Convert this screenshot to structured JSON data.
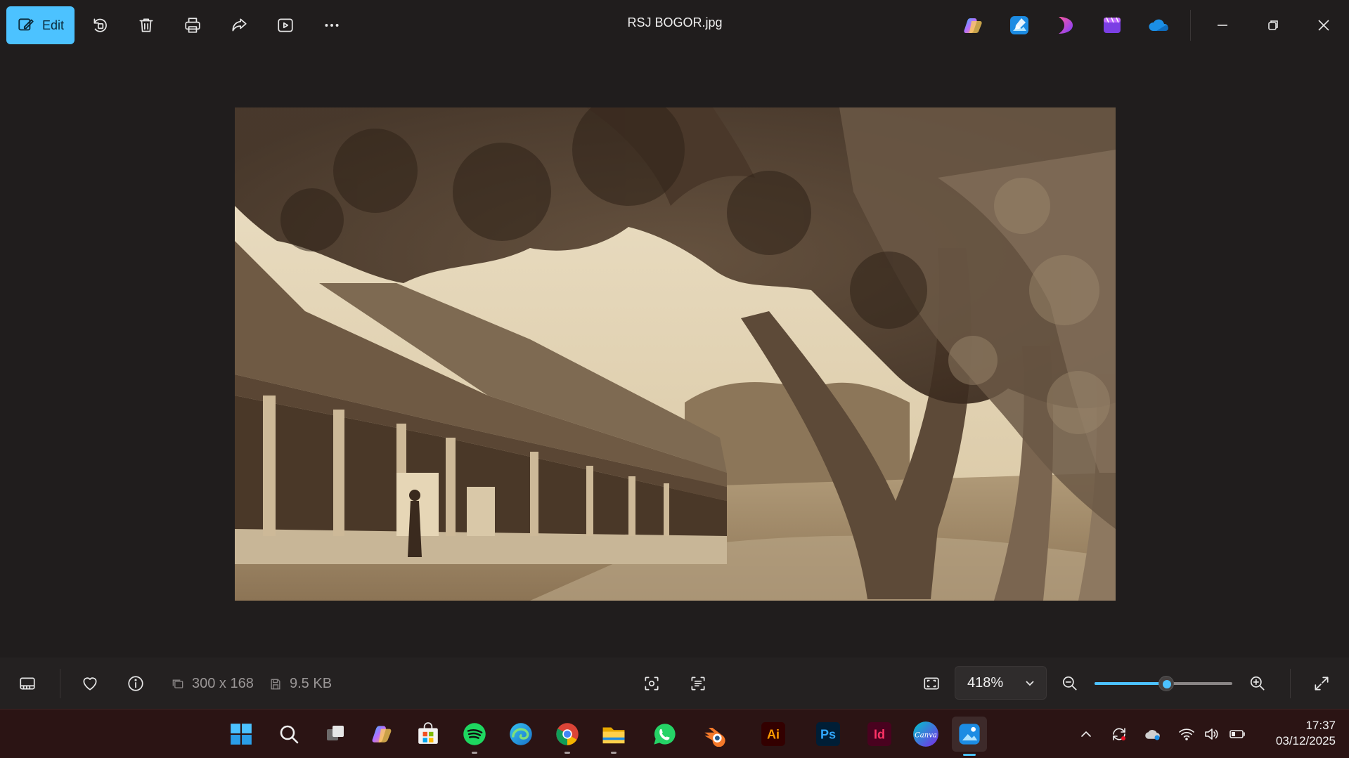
{
  "window": {
    "title": "RSJ BOGOR.jpg",
    "edit_label": "Edit"
  },
  "toolbar": {
    "icons": [
      "edit-icon",
      "rotate-icon",
      "delete-icon",
      "print-icon",
      "share-icon",
      "slideshow-icon",
      "more-icon"
    ]
  },
  "pinned_apps": [
    "copilot",
    "photos-designer",
    "clipchamp-pink",
    "clipchamp",
    "onedrive"
  ],
  "info": {
    "dimensions": "300 x 168",
    "file_size": "9.5 KB",
    "zoom": "418%",
    "zoom_level": 0.52
  },
  "taskbar": {
    "apps": [
      "start",
      "search",
      "task-view",
      "copilot",
      "microsoft-store",
      "spotify",
      "edge",
      "chrome",
      "file-explorer",
      "whatsapp",
      "blender",
      "illustrator",
      "photoshop",
      "indesign",
      "canva",
      "photos"
    ],
    "illustrator_label": "Ai",
    "photoshop_label": "Ps",
    "indesign_label": "Id",
    "canva_label": "Canva"
  },
  "clock": {
    "time": "17:37",
    "date": "03/12/2025"
  },
  "colors": {
    "accent": "#4cc2ff",
    "background": "#201d1d",
    "taskbar": "#2b1414"
  }
}
